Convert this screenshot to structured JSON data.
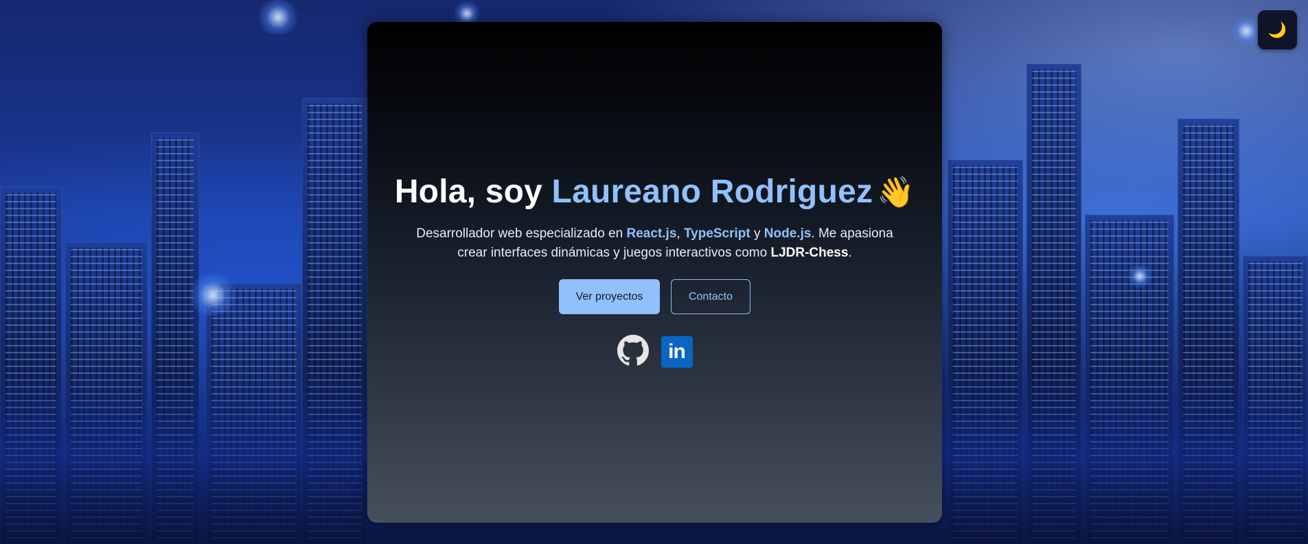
{
  "theme_toggle": {
    "icon": "moon-icon",
    "glyph": "🌙"
  },
  "hero": {
    "greeting": "Hola, soy ",
    "name": "Laureano Rodriguez",
    "wave_emoji": "👋",
    "description": {
      "part1": "Desarrollador web especializado en ",
      "tech1": "React.js",
      "sep1": ", ",
      "tech2": "TypeScript",
      "sep2": " y ",
      "tech3": "Node.js",
      "part2": ". Me apasiona crear interfaces dinámicas y juegos interactivos como ",
      "project": "LJDR-Chess",
      "part3": "."
    },
    "buttons": {
      "projects_label": "Ver proyectos",
      "contact_label": "Contacto"
    },
    "socials": [
      {
        "name": "GitHub",
        "icon": "github-icon"
      },
      {
        "name": "LinkedIn",
        "icon": "linkedin-icon",
        "glyph": "in"
      }
    ]
  },
  "colors": {
    "accent": "#90c1fb",
    "linkedin": "#0a66c2",
    "card_top": "#000000",
    "card_bottom": "#46505d"
  }
}
